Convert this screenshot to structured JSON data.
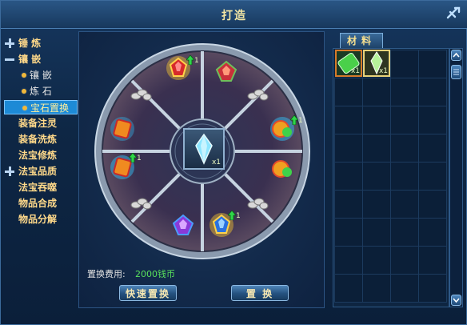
{
  "window": {
    "title": "打造"
  },
  "nav": [
    {
      "label": "锤  炼",
      "type": "plus"
    },
    {
      "label": "镶  嵌",
      "type": "minus"
    },
    {
      "label": "镶 嵌",
      "type": "sub"
    },
    {
      "label": "炼 石",
      "type": "sub"
    },
    {
      "label": "宝石置换",
      "type": "sub-selected"
    },
    {
      "label": "装备注灵",
      "type": "item"
    },
    {
      "label": "装备洗炼",
      "type": "item"
    },
    {
      "label": "法宝修炼",
      "type": "item"
    },
    {
      "label": "法宝品质",
      "type": "plus"
    },
    {
      "label": "法宝吞噬",
      "type": "item"
    },
    {
      "label": "物品合成",
      "type": "item"
    },
    {
      "label": "物品分解",
      "type": "item"
    }
  ],
  "wheel": {
    "center_qty": "x1",
    "slots": [
      {
        "name": "gem-red-gold",
        "qty": "1"
      },
      {
        "name": "gem-red-purple",
        "qty": ""
      },
      {
        "name": "gem-orange-green",
        "qty": "1"
      },
      {
        "name": "gem-orange-green-2",
        "qty": ""
      },
      {
        "name": "gem-blue-gold",
        "qty": "1"
      },
      {
        "name": "gem-purple-blue",
        "qty": ""
      },
      {
        "name": "gem-orange-blue",
        "qty": "1"
      },
      {
        "name": "gem-orange-blue-2",
        "qty": ""
      }
    ]
  },
  "cost": {
    "label": "置换费用:",
    "value": "2000钱币"
  },
  "buttons": {
    "quick": "快速置换",
    "swap": "置  换"
  },
  "materials": {
    "tab": "材料",
    "items": [
      {
        "name": "material-green-scroll",
        "qty": "x1"
      },
      {
        "name": "material-gold-crystal",
        "qty": "x1"
      }
    ]
  },
  "colors": {
    "accent": "#ffd98a",
    "selected": "#1d8ad6",
    "cost": "#59e05c",
    "arrow": "#2fd64a"
  }
}
